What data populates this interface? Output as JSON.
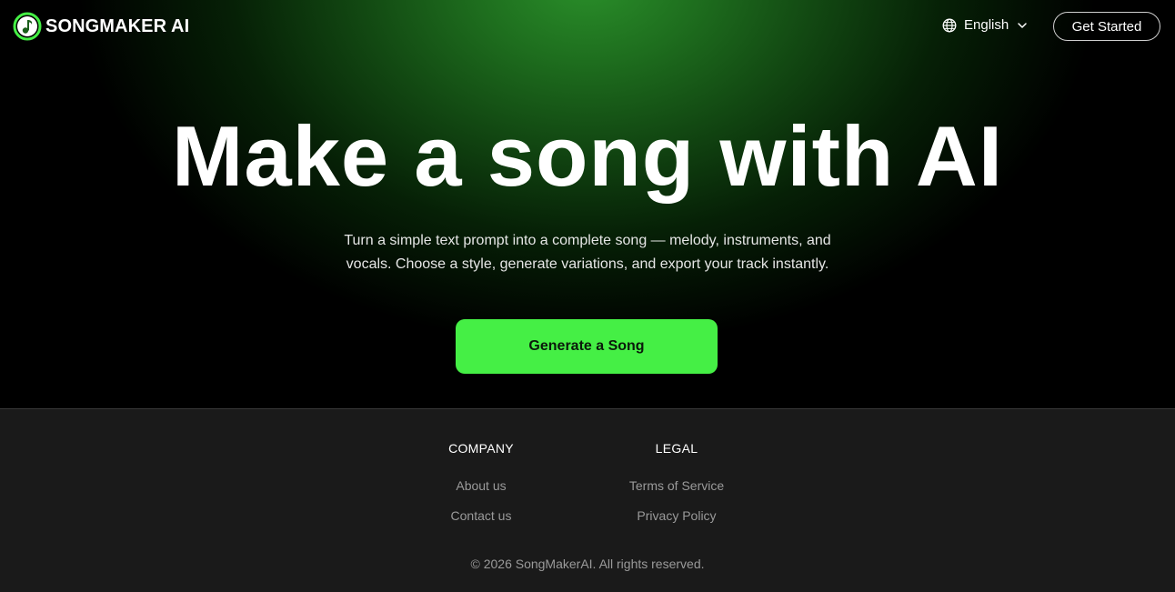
{
  "brand": {
    "name": "SONGMAKER AI",
    "accent_color": "#45ef45",
    "logo_icon": "music-note-icon"
  },
  "header": {
    "language_label": "English",
    "language_icon": "globe-icon",
    "get_started_label": "Get Started"
  },
  "hero": {
    "headline": "Make a song with AI",
    "subtitle_line1": "Turn a simple text prompt into a complete song — melody, instruments, and",
    "subtitle_line2": "vocals. Choose a style, generate variations, and export your track instantly.",
    "cta_label": "Generate a Song"
  },
  "footer": {
    "columns": [
      {
        "title": "COMPANY",
        "links": [
          "About us",
          "Contact us"
        ]
      },
      {
        "title": "LEGAL",
        "links": [
          "Terms of Service",
          "Privacy Policy"
        ]
      }
    ],
    "copyright": "© 2026 SongMakerAI. All rights reserved."
  }
}
